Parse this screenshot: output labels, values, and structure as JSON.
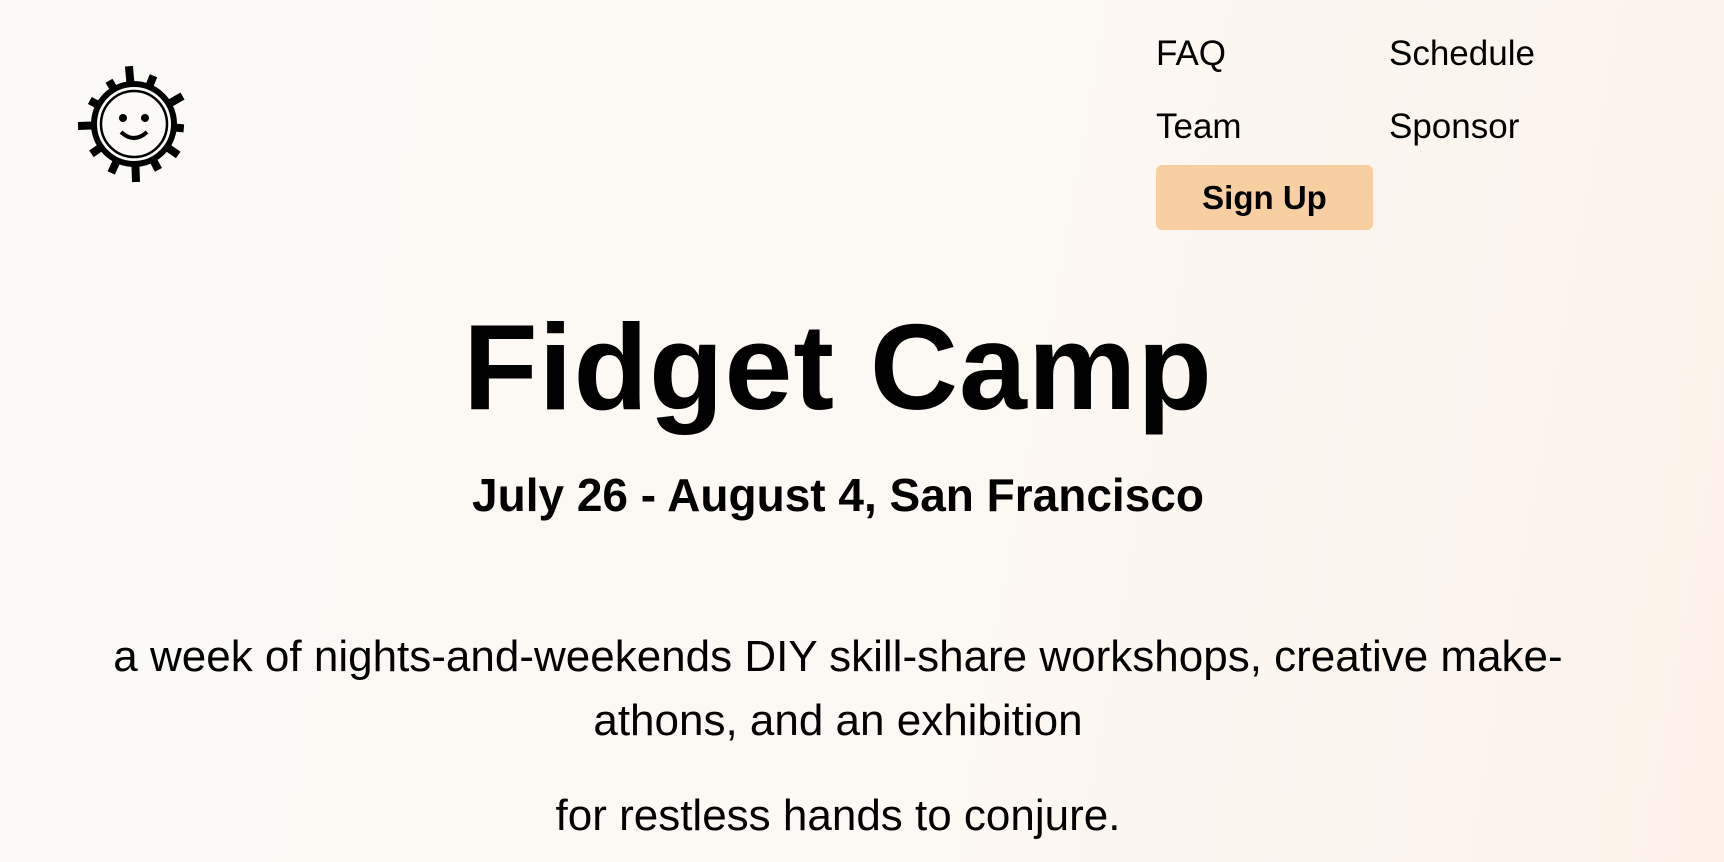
{
  "logo": {
    "icon": "sun-smiley-icon"
  },
  "nav": {
    "faq": "FAQ",
    "schedule": "Schedule",
    "team": "Team",
    "sponsor": "Sponsor",
    "signup": "Sign Up"
  },
  "hero": {
    "title": "Fidget Camp",
    "dates": "July 26 - August 4, San Francisco",
    "description": "a week of nights-and-weekends DIY skill-share workshops, creative make-athons, and an exhibition",
    "tagline": "for restless hands to conjure."
  },
  "colors": {
    "signup_bg": "#f7cfa1",
    "background": "#fbf8f4",
    "text": "#000000"
  }
}
